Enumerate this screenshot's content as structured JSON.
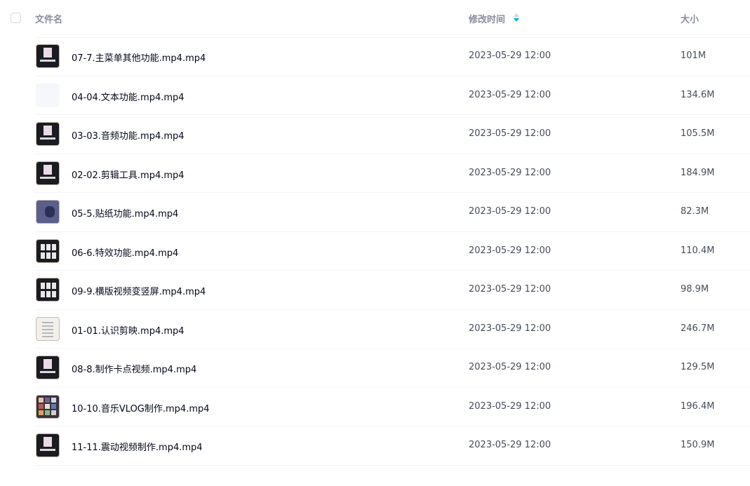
{
  "header": {
    "name_label": "文件名",
    "time_label": "修改时间",
    "size_label": "大小",
    "sort_icon": "sort-icon",
    "accent_color": "#06a7ff"
  },
  "files": [
    {
      "name": "07-7.主菜单其他功能.mp4.mp4",
      "time": "2023-05-29 12:00",
      "size": "101M",
      "thumb": "dark"
    },
    {
      "name": "04-04.文本功能.mp4.mp4",
      "time": "2023-05-29 12:00",
      "size": "134.6M",
      "thumb": "blank"
    },
    {
      "name": "03-03.音频功能.mp4.mp4",
      "time": "2023-05-29 12:00",
      "size": "105.5M",
      "thumb": "dark"
    },
    {
      "name": "02-02.剪辑工具.mp4.mp4",
      "time": "2023-05-29 12:00",
      "size": "184.9M",
      "thumb": "dark"
    },
    {
      "name": "05-5.贴纸功能.mp4.mp4",
      "time": "2023-05-29 12:00",
      "size": "82.3M",
      "thumb": "sticker"
    },
    {
      "name": "06-6.特效功能.mp4.mp4",
      "time": "2023-05-29 12:00",
      "size": "110.4M",
      "thumb": "grid"
    },
    {
      "name": "09-9.横版视频变竖屏.mp4.mp4",
      "time": "2023-05-29 12:00",
      "size": "98.9M",
      "thumb": "grid"
    },
    {
      "name": "01-01.认识剪映.mp4.mp4",
      "time": "2023-05-29 12:00",
      "size": "246.7M",
      "thumb": "light"
    },
    {
      "name": "08-8.制作卡点视频.mp4.mp4",
      "time": "2023-05-29 12:00",
      "size": "129.5M",
      "thumb": "dark"
    },
    {
      "name": "10-10.音乐VLOG制作.mp4.mp4",
      "time": "2023-05-29 12:00",
      "size": "196.4M",
      "thumb": "mosaic"
    },
    {
      "name": "11-11.震动视频制作.mp4.mp4",
      "time": "2023-05-29 12:00",
      "size": "150.9M",
      "thumb": "dark"
    }
  ]
}
